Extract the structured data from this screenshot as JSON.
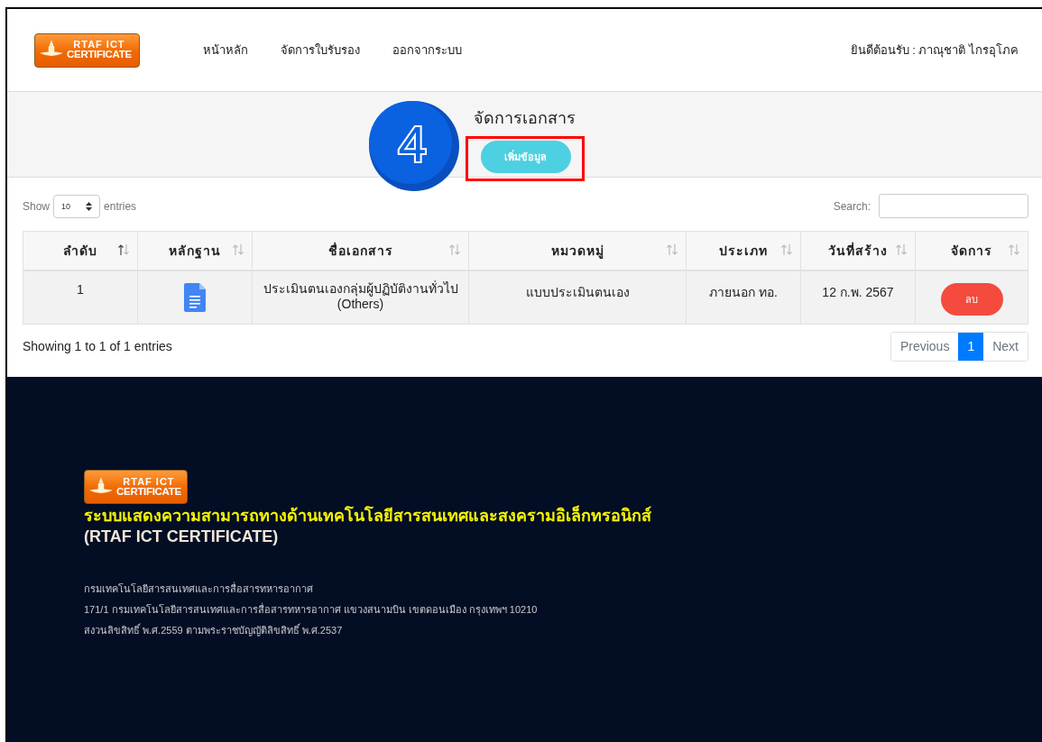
{
  "header": {
    "logo_text": [
      "RTAF ICT",
      "CERTIFICATE"
    ],
    "nav": [
      {
        "label": "หน้าหลัก"
      },
      {
        "label": "จัดการใบรับรอง"
      },
      {
        "label": "ออกจากระบบ"
      }
    ],
    "welcome": "ยินดีต้อนรับ : ภาณุชาติ ไกรอุโภค"
  },
  "toolbar": {
    "title": "จัดการเอกสาร",
    "add_button": "เพิ่มข้อมูล",
    "annotation": {
      "number": "4"
    }
  },
  "table_controls": {
    "show_label": "Show",
    "page_size": "10",
    "entries_label": "entries",
    "search_label": "Search:"
  },
  "table": {
    "columns": [
      {
        "label": "ลำดับ",
        "sorted": true
      },
      {
        "label": "หลักฐาน",
        "sorted": false
      },
      {
        "label": "ชื่อเอกสาร",
        "sorted": false
      },
      {
        "label": "หมวดหมู่",
        "sorted": false
      },
      {
        "label": "ประเภท",
        "sorted": false
      },
      {
        "label": "วันที่สร้าง",
        "sorted": false
      },
      {
        "label": "จัดการ",
        "sorted": false
      }
    ],
    "rows": [
      {
        "number": "1",
        "evidence": {
          "kind": "document"
        },
        "name": [
          "ประเมินตนเองกลุ่มผู้ปฏิบัติงานทั่วไป",
          "(Others)"
        ],
        "category": "แบบประเมินตนเอง",
        "type": "ภายนอก ทอ.",
        "created": "12 ก.พ. 2567",
        "action": "ลบ"
      }
    ]
  },
  "info": "Showing 1 to 1 of 1 entries",
  "pagination": [
    {
      "label": "Previous",
      "selected": false
    },
    {
      "label": "1",
      "selected": true
    },
    {
      "label": "Next",
      "selected": false
    }
  ],
  "footer": {
    "logo_text": [
      "RTAF ICT",
      "CERTIFICATE"
    ],
    "title": "ระบบแสดงความสามารถทางด้านเทคโนโลยีสารสนเทศและสงครามอิเล็กทรอนิกส์",
    "subtitle": "(RTAF ICT CERTIFICATE)",
    "lines": [
      "กรมเทคโนโลยีสารสนเทศและการสื่อสารทหารอากาศ",
      "171/1 กรมเทคโนโลยีสารสนเทศและการสื่อสารทหารอากาศ แขวงสนามบิน เขตดอนเมือง กรุงเทพฯ 10210",
      "สงวนลิขสิทธิ์ พ.ศ.2559 ตามพระราชบัญญัติลิขสิทธิ์ พ.ศ.2537"
    ]
  }
}
